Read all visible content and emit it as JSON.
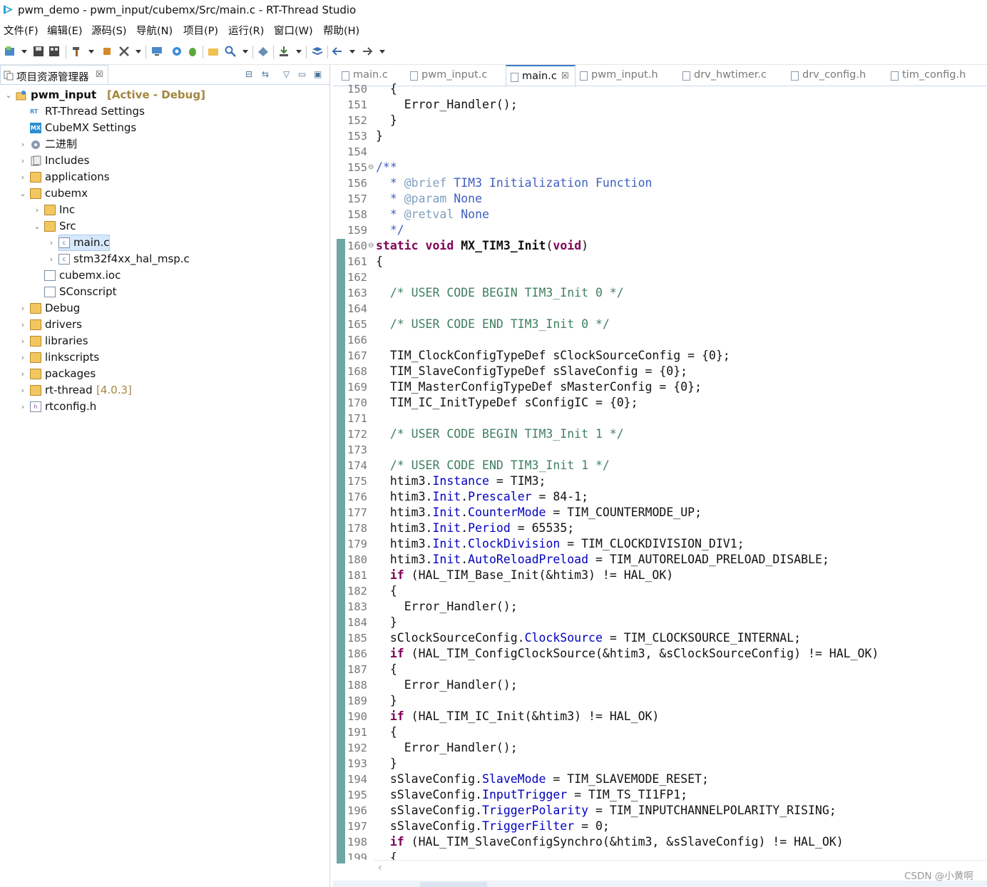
{
  "window": {
    "title": "pwm_demo - pwm_input/cubemx/Src/main.c - RT-Thread Studio"
  },
  "menu": [
    "文件(F)",
    "编辑(E)",
    "源码(S)",
    "导航(N)",
    "项目(P)",
    "运行(R)",
    "窗口(W)",
    "帮助(H)"
  ],
  "project_explorer": {
    "tab_label": "项目资源管理器",
    "close_glyph": "☒",
    "project_name": "pwm_input",
    "project_state": "[Active - Debug]",
    "items": {
      "rt_thread_settings": "RT-Thread Settings",
      "cubemx_settings": "CubeMX Settings",
      "binaries": "二进制",
      "includes": "Includes",
      "applications": "applications",
      "cubemx": "cubemx",
      "inc": "Inc",
      "src": "Src",
      "main_c": "main.c",
      "hal_msp": "stm32f4xx_hal_msp.c",
      "cubemx_ioc": "cubemx.ioc",
      "sconscript": "SConscript",
      "debug": "Debug",
      "drivers": "drivers",
      "libraries": "libraries",
      "linkscripts": "linkscripts",
      "packages": "packages",
      "rt_thread": "rt-thread",
      "rt_thread_version": "[4.0.3]",
      "rtconfig_h": "rtconfig.h"
    }
  },
  "editor": {
    "tabs": [
      "main.c",
      "pwm_input.c",
      "main.c",
      "pwm_input.h",
      "drv_hwtimer.c",
      "drv_config.h",
      "tim_config.h"
    ],
    "active_tab_index": 2,
    "active_close_glyph": "☒",
    "line_numbers": [
      "150",
      "151",
      "152",
      "153",
      "154",
      "155",
      "156",
      "157",
      "158",
      "159",
      "160",
      "161",
      "162",
      "163",
      "164",
      "165",
      "166",
      "167",
      "168",
      "169",
      "170",
      "171",
      "172",
      "173",
      "174",
      "175",
      "176",
      "177",
      "178",
      "179",
      "180",
      "181",
      "182",
      "183",
      "184",
      "185",
      "186",
      "187",
      "188",
      "189",
      "190",
      "191",
      "192",
      "193",
      "194",
      "195",
      "196",
      "197",
      "198",
      "199"
    ],
    "code": {
      "l150": "  {",
      "l151": "    Error_Handler();",
      "l152": "  }",
      "l153": "}",
      "l155": "/**",
      "l156_star": "  * ",
      "l156_tag": "@brief",
      "l156_text": " TIM3 Initialization Function",
      "l157_star": "  * ",
      "l157_tag": "@param",
      "l157_text": " None",
      "l158_star": "  * ",
      "l158_tag": "@retval",
      "l158_text": " None",
      "l159": "  */",
      "l160_kw1": "static",
      "l160_kw2": "void",
      "l160_fn": "MX_TIM3_Init",
      "l160_kw3": "void",
      "l161": "{",
      "l163": "  /* USER CODE BEGIN TIM3_Init 0 */",
      "l165": "  /* USER CODE END TIM3_Init 0 */",
      "l167": "  TIM_ClockConfigTypeDef sClockSourceConfig = {0};",
      "l168": "  TIM_SlaveConfigTypeDef sSlaveConfig = {0};",
      "l169": "  TIM_MasterConfigTypeDef sMasterConfig = {0};",
      "l170": "  TIM_IC_InitTypeDef sConfigIC = {0};",
      "l172": "  /* USER CODE BEGIN TIM3_Init 1 */",
      "l174": "  /* USER CODE END TIM3_Init 1 */",
      "htim3": "  htim3.",
      "f_instance": "Instance",
      "l175_rest": " = TIM3;",
      "f_init": "Init",
      "dot": ".",
      "f_prescaler": "Prescaler",
      "l176_rest": " = 84-1;",
      "f_countermode": "CounterMode",
      "l177_rest": " = TIM_COUNTERMODE_UP;",
      "f_period": "Period",
      "l178_rest": " = 65535;",
      "f_clockdivision": "ClockDivision",
      "l179_rest": " = TIM_CLOCKDIVISION_DIV1;",
      "f_autoreload": "AutoReloadPreload",
      "l180_rest": " = TIM_AUTORELOAD_PRELOAD_DISABLE;",
      "kw_if": "if",
      "l181_rest": " (HAL_TIM_Base_Init(&htim3) != HAL_OK)",
      "open_brace": "  {",
      "error_call": "    Error_Handler();",
      "close_brace": "  }",
      "l185_obj": "  sClockSourceConfig.",
      "f_clocksource": "ClockSource",
      "l185_rest": " = TIM_CLOCKSOURCE_INTERNAL;",
      "l186_rest": " (HAL_TIM_ConfigClockSource(&htim3, &sClockSourceConfig) != HAL_OK)",
      "l190_rest": " (HAL_TIM_IC_Init(&htim3) != HAL_OK)",
      "l194_obj": "  sSlaveConfig.",
      "f_slavemode": "SlaveMode",
      "l194_rest": " = TIM_SLAVEMODE_RESET;",
      "f_inputtrigger": "InputTrigger",
      "l195_rest": " = TIM_TS_TI1FP1;",
      "f_triggerpolarity": "TriggerPolarity",
      "l196_rest": " = TIM_INPUTCHANNELPOLARITY_RISING;",
      "f_triggerfilter": "TriggerFilter",
      "l197_rest": " = 0;",
      "l198_rest": " (HAL_TIM_SlaveConfigSynchro(&htim3, &sSlaveConfig) != HAL_OK)"
    }
  },
  "watermark": "CSDN @小黄啊"
}
